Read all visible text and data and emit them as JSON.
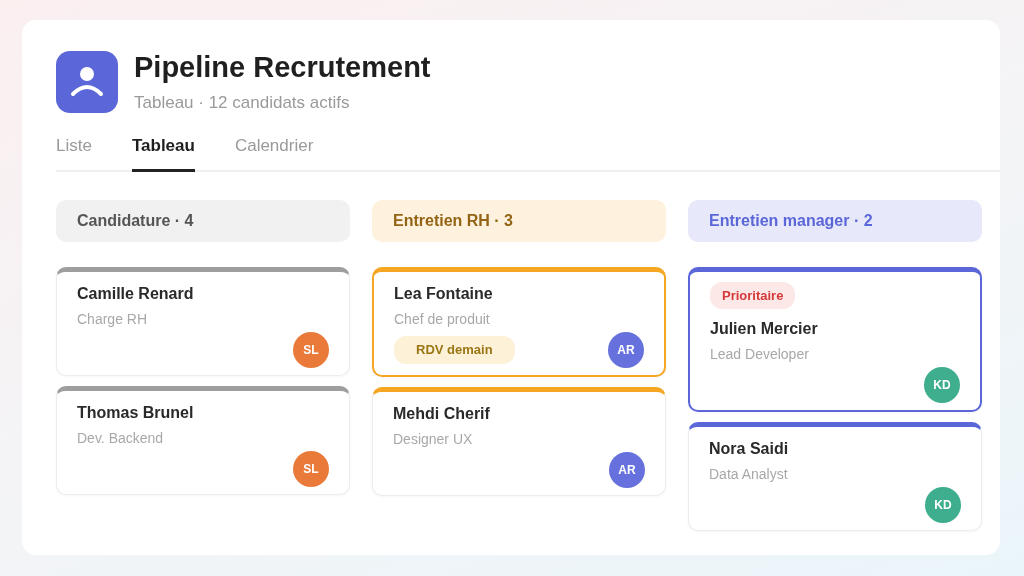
{
  "header": {
    "title": "Pipeline Recrutement",
    "subtitle": "Tableau · 12 candidats actifs"
  },
  "tabs": [
    {
      "label": "Liste",
      "selected": false
    },
    {
      "label": "Tableau",
      "selected": true
    },
    {
      "label": "Calendrier",
      "selected": false
    }
  ],
  "columns": [
    {
      "title": "Candidature · 4",
      "color": "#9e9e9e",
      "cards": [
        {
          "name": "Camille Renard",
          "role": "Charge RH",
          "highlighted": false,
          "avatar": {
            "initials": "SL",
            "color": "#ea7a3a"
          }
        },
        {
          "name": "Thomas Brunel",
          "role": "Dev. Backend",
          "highlighted": false,
          "avatar": {
            "initials": "SL",
            "color": "#ea7a3a"
          }
        }
      ]
    },
    {
      "title": "Entretien RH · 3",
      "color": "#f5a623",
      "cards": [
        {
          "name": "Lea Fontaine",
          "role": "Chef de produit",
          "highlighted": true,
          "tag": {
            "label": "RDV demain",
            "kind": "warning"
          },
          "avatar": {
            "initials": "AR",
            "color": "#6671dd"
          }
        },
        {
          "name": "Mehdi Cherif",
          "role": "Designer UX",
          "highlighted": false,
          "avatar": {
            "initials": "AR",
            "color": "#6671dd"
          }
        }
      ]
    },
    {
      "title": "Entretien manager · 2",
      "color": "#5b67d8",
      "cards": [
        {
          "name": "Julien Mercier",
          "role": "Lead Developer",
          "highlighted": true,
          "tag": {
            "label": "Prioritaire",
            "kind": "danger"
          },
          "avatar": {
            "initials": "KD",
            "color": "#3fae8e"
          }
        },
        {
          "name": "Nora Saidi",
          "role": "Data Analyst",
          "highlighted": false,
          "avatar": {
            "initials": "KD",
            "color": "#3fae8e"
          }
        }
      ]
    }
  ]
}
